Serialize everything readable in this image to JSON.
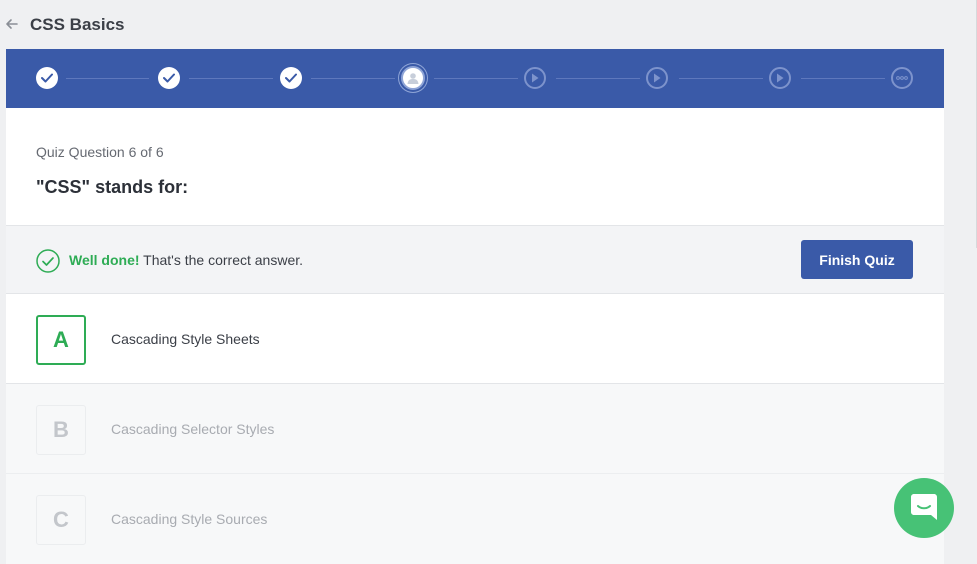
{
  "header": {
    "course_title": "CSS Basics",
    "back_icon": "arrow-left-icon"
  },
  "progress": {
    "steps": [
      {
        "state": "completed",
        "icon": "checkmark-icon"
      },
      {
        "state": "completed",
        "icon": "checkmark-icon"
      },
      {
        "state": "completed",
        "icon": "checkmark-icon"
      },
      {
        "state": "current",
        "icon": "person-icon"
      },
      {
        "state": "pending",
        "icon": "play-icon"
      },
      {
        "state": "pending",
        "icon": "play-icon"
      },
      {
        "state": "pending",
        "icon": "play-icon"
      },
      {
        "state": "pending",
        "icon": "more-dots-icon"
      }
    ],
    "colors": {
      "bar": "#3a5aa8"
    }
  },
  "question": {
    "counter": "Quiz Question 6 of 6",
    "text": "\"CSS\" stands for:"
  },
  "feedback": {
    "strong": "Well done!",
    "message": "That's the correct answer.",
    "icon": "check-circle-icon",
    "finish_label": "Finish Quiz",
    "colors": {
      "success": "#2eac55",
      "button": "#3a5aa8"
    }
  },
  "answers": [
    {
      "letter": "A",
      "text": "Cascading Style Sheets",
      "state": "correct"
    },
    {
      "letter": "B",
      "text": "Cascading Selector Styles",
      "state": "dimmed"
    },
    {
      "letter": "C",
      "text": "Cascading Style Sources",
      "state": "dimmed"
    }
  ],
  "chat": {
    "icon": "chat-bubble-icon",
    "color": "#47c276"
  }
}
